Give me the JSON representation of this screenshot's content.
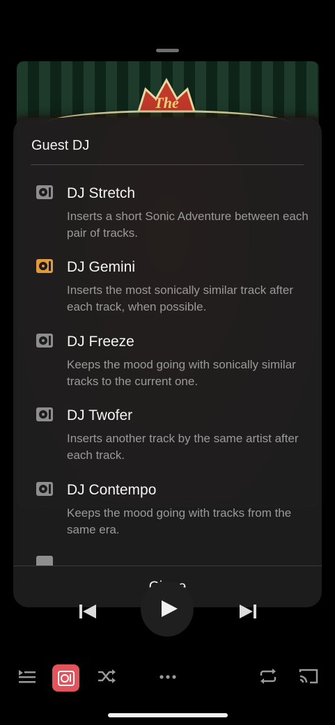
{
  "sheet": {
    "title": "Guest DJ",
    "close_label": "Close",
    "items": [
      {
        "name": "DJ Stretch",
        "description": "Inserts a short Sonic Adventure between each pair of tracks.",
        "icon": "dj-turntable-icon",
        "selected": false
      },
      {
        "name": "DJ Gemini",
        "description": "Inserts the most sonically similar track after each track, when possible.",
        "icon": "dj-turntable-icon",
        "selected": true
      },
      {
        "name": "DJ Freeze",
        "description": "Keeps the mood going with sonically similar tracks to the current one.",
        "icon": "dj-turntable-icon",
        "selected": false
      },
      {
        "name": "DJ Twofer",
        "description": "Inserts another track by the same artist after each track.",
        "icon": "dj-turntable-icon",
        "selected": false
      },
      {
        "name": "DJ Contempo",
        "description": "Keeps the mood going with tracks from the same era.",
        "icon": "dj-turntable-icon",
        "selected": false
      }
    ]
  },
  "artwork": {
    "text": "The"
  },
  "colors": {
    "accent_orange": "#e39a3b",
    "icon_gray": "#8e8e8e",
    "dj_active_bg": "#e2545c",
    "sheet_bg": "#1e1e1e"
  },
  "transport": {
    "icons": [
      "previous-icon",
      "play-icon",
      "next-icon"
    ]
  },
  "bottom_bar": {
    "icons": [
      "queue-icon",
      "guest-dj-icon",
      "shuffle-icon",
      "more-icon",
      "repeat-icon",
      "cast-icon"
    ]
  }
}
